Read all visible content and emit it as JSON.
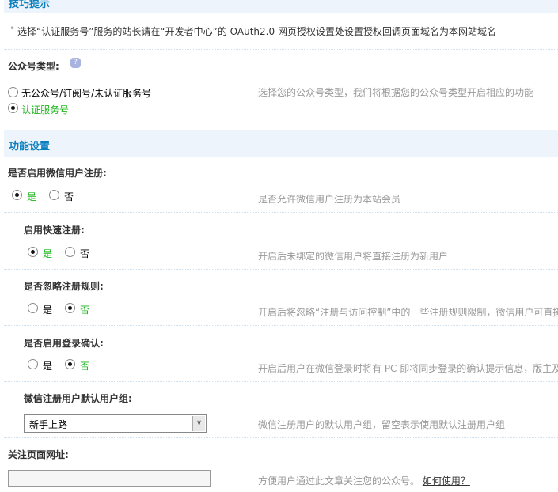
{
  "tips": {
    "title": "技巧提示",
    "text": "选择“认证服务号”服务的站长请在“开发者中心”的 OAuth2.0 网页授权设置处设置授权回调页面域名为本网站域名"
  },
  "account_type": {
    "label": "公众号类型:",
    "options": [
      "无公众号/订阅号/未认证服务号",
      "认证服务号"
    ],
    "selected": 1,
    "desc": "选择您的公众号类型，我们将根据您的公众号类型开启相应的功能"
  },
  "features": {
    "title": "功能设置"
  },
  "settings": [
    {
      "label": "是否启用微信用户注册:",
      "yes": "是",
      "no": "否",
      "selected": "yes",
      "desc": "是否允许微信用户注册为本站会员"
    },
    {
      "label": "启用快速注册:",
      "yes": "是",
      "no": "否",
      "selected": "yes",
      "desc": "开启后未绑定的微信用户将直接注册为新用户"
    },
    {
      "label": "是否忽略注册规则:",
      "yes": "是",
      "no": "否",
      "selected": "no",
      "desc": "开启后将忽略“注册与访问控制”中的一些注册规则限制，微信用户可直接"
    },
    {
      "label": "是否启用登录确认:",
      "yes": "是",
      "no": "否",
      "selected": "no",
      "desc": "开启后用户在微信登录时将有 PC 即将同步登录的确认提示信息，版主及"
    }
  ],
  "user_group": {
    "label": "微信注册用户默认用户组:",
    "value": "新手上路",
    "desc": "微信注册用户的默认用户组，留空表示使用默认注册用户组"
  },
  "follow_url": {
    "label": "关注页面网址:",
    "value": "",
    "desc": "方便用户通过此文章关注您的公众号。",
    "link": "如何使用？"
  }
}
